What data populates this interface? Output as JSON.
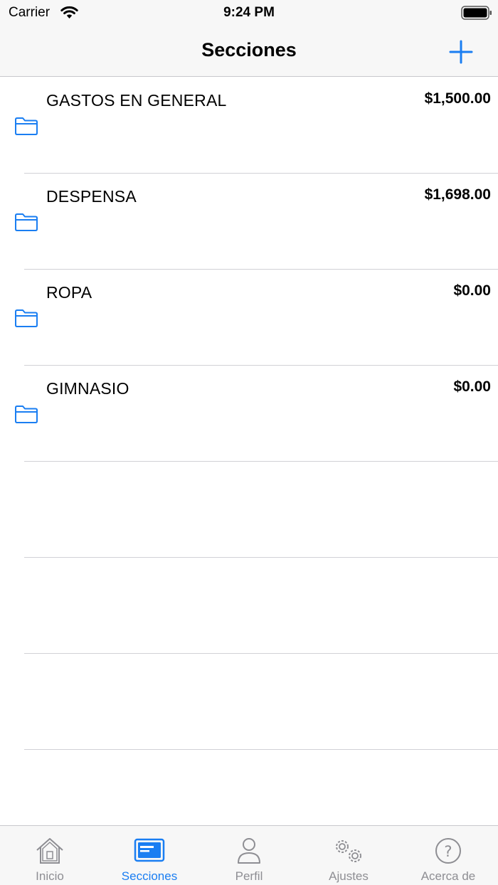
{
  "status_bar": {
    "carrier": "Carrier",
    "time": "9:24 PM"
  },
  "nav": {
    "title": "Secciones",
    "add_icon": "plus-icon"
  },
  "sections": [
    {
      "name": "GASTOS EN GENERAL",
      "amount": "$1,500.00",
      "icon": "folder-icon"
    },
    {
      "name": "DESPENSA",
      "amount": "$1,698.00",
      "icon": "folder-icon"
    },
    {
      "name": "ROPA",
      "amount": "$0.00",
      "icon": "folder-icon"
    },
    {
      "name": "GIMNASIO",
      "amount": "$0.00",
      "icon": "folder-icon"
    }
  ],
  "tabs": [
    {
      "label": "Inicio",
      "icon": "home-icon",
      "active": false
    },
    {
      "label": "Secciones",
      "icon": "card-icon",
      "active": true
    },
    {
      "label": "Perfil",
      "icon": "person-icon",
      "active": false
    },
    {
      "label": "Ajustes",
      "icon": "gears-icon",
      "active": false
    },
    {
      "label": "Acerca de",
      "icon": "question-icon",
      "active": false
    }
  ],
  "colors": {
    "accent": "#1a7ef2",
    "inactive": "#8e8e93",
    "bar_background": "#f7f7f7"
  }
}
